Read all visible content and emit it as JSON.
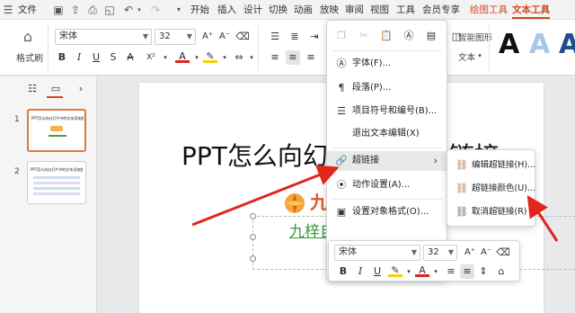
{
  "menubar": {
    "file": "文件",
    "items": [
      "开始",
      "插入",
      "设计",
      "切换",
      "动画",
      "放映",
      "审阅",
      "视图",
      "工具",
      "会员专享",
      "绘图工具",
      "文本工具"
    ]
  },
  "ribbon": {
    "format_painter": "格式刷",
    "font_name": "宋体",
    "font_size": "32",
    "smart_shape": "智能图形",
    "text_label": "文本"
  },
  "slides": [
    {
      "number": "1",
      "title": "PPT怎么向幻灯片中的文本添加超链接"
    },
    {
      "number": "2",
      "title": "PPT怎么向幻灯片中的文本添加超链接"
    }
  ],
  "slide": {
    "title_left": "PPT怎么向幻",
    "title_right": "链接",
    "logo_text": "九",
    "link_text": "九梓自科全说"
  },
  "context_menu": {
    "items": [
      {
        "label": "字体(F)...",
        "icon": "font-icon"
      },
      {
        "label": "段落(P)...",
        "icon": "paragraph-icon"
      },
      {
        "label": "项目符号和编号(B)...",
        "icon": "bullets-icon"
      },
      {
        "label": "退出文本编辑(X)",
        "icon": ""
      },
      {
        "label": "超链接",
        "icon": "hyperlink-icon"
      },
      {
        "label": "动作设置(A)...",
        "icon": "action-icon"
      },
      {
        "label": "设置对象格式(O)...",
        "icon": "format-object-icon"
      }
    ]
  },
  "submenu": {
    "items": [
      {
        "label": "编辑超链接(H)...",
        "icon": "edit-link-icon"
      },
      {
        "label": "超链接颜色(U)...",
        "icon": "link-color-icon"
      },
      {
        "label": "取消超链接(R)",
        "icon": "remove-link-icon"
      }
    ]
  },
  "mini_toolbar": {
    "font_name": "宋体",
    "font_size": "32"
  },
  "colors": {
    "accent": "#d24726",
    "arrow": "#e0261d",
    "link": "#3a9a3a"
  }
}
